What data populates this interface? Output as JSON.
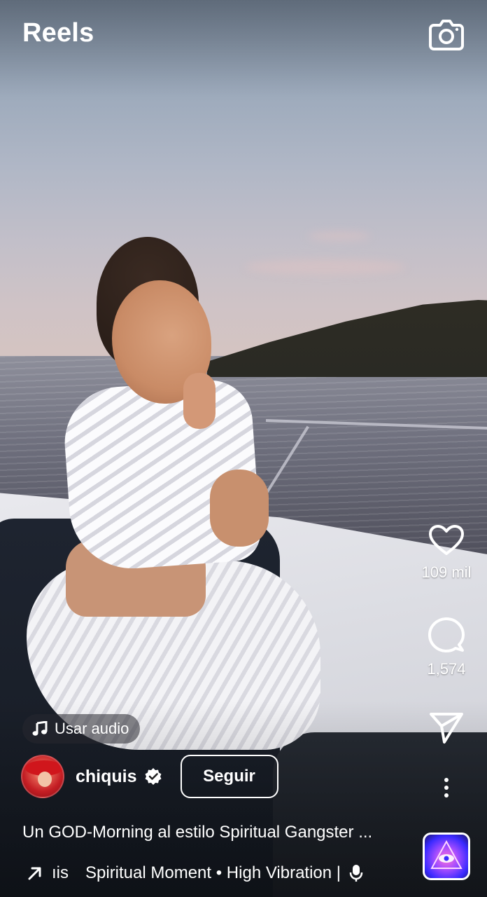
{
  "header": {
    "title": "Reels",
    "camera_icon": "camera-icon"
  },
  "actions": {
    "like": {
      "icon": "heart-icon",
      "count": "109 mil"
    },
    "comment": {
      "icon": "comment-icon",
      "count": "1,574"
    },
    "share": {
      "icon": "send-icon"
    },
    "more": {
      "icon": "more-vertical-icon"
    }
  },
  "audio_chip": {
    "icon": "music-note-icon",
    "label": "Usar audio"
  },
  "author": {
    "username": "chiquis",
    "verified": true,
    "follow_label": "Seguir"
  },
  "caption": "Un GOD-Morning al estilo Spiritual Gangster ...",
  "music": {
    "arrow_icon": "trending-arrow-icon",
    "scroll_prefix": "ıis",
    "track": "Spiritual Moment • High Vibration |",
    "mic_icon": "microphone-icon"
  },
  "colors": {
    "text": "#ffffff",
    "chip_bg": "rgba(40,40,48,0.55)"
  }
}
